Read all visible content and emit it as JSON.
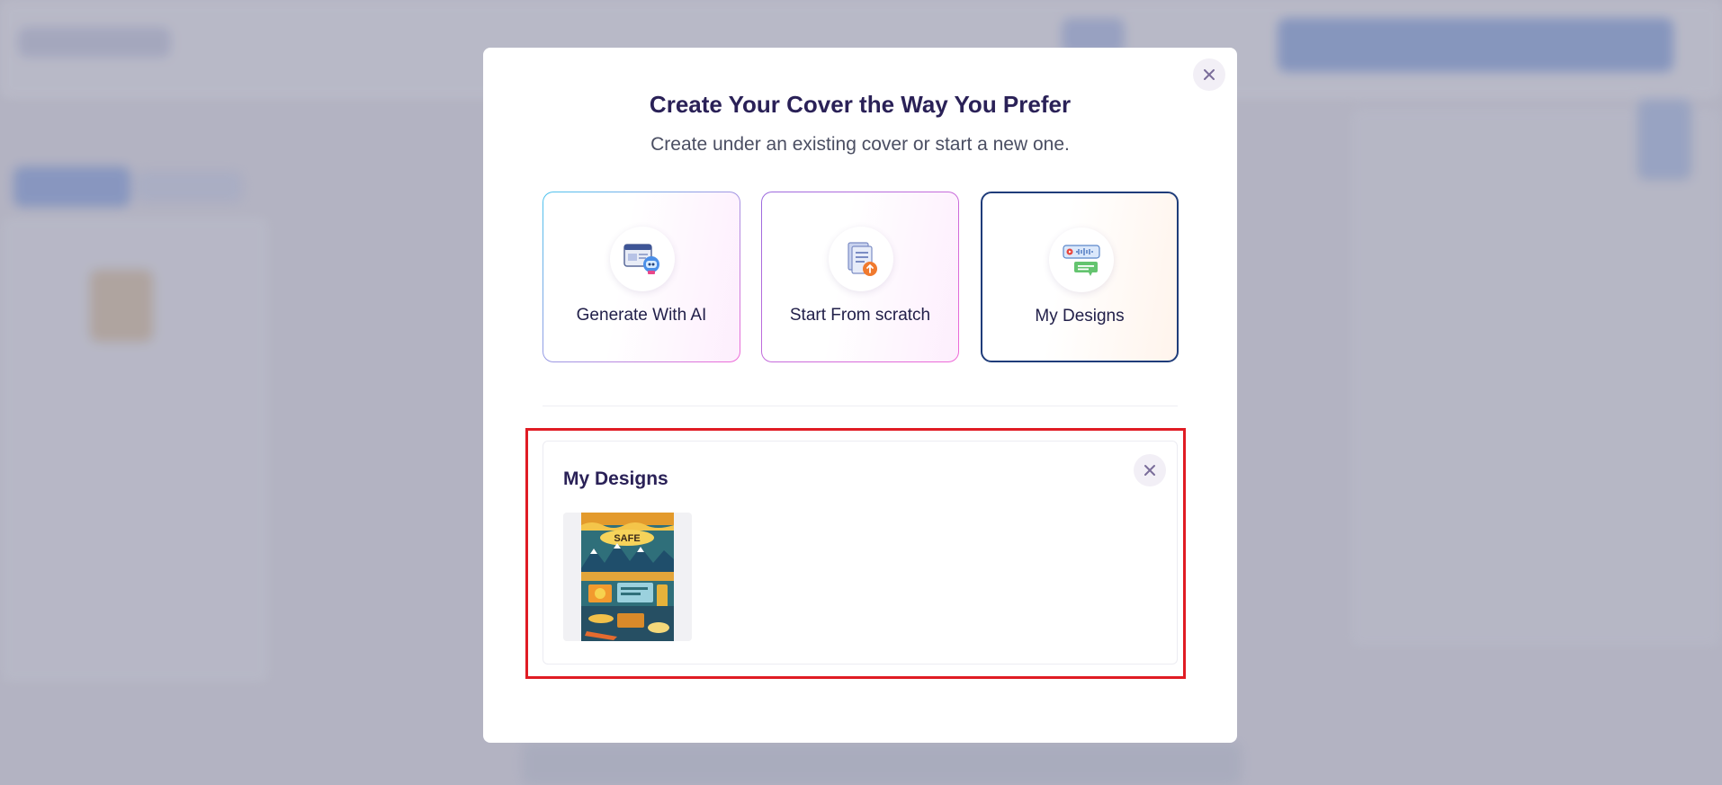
{
  "modal": {
    "title": "Create Your Cover the Way You Prefer",
    "subtitle": "Create under an existing cover or start a new one.",
    "close_icon": "close-icon"
  },
  "options": [
    {
      "label": "Generate With AI",
      "icon": "ai-generate-icon"
    },
    {
      "label": "Start From scratch",
      "icon": "document-upload-icon"
    },
    {
      "label": "My Designs",
      "icon": "chat-designs-icon",
      "selected": true
    }
  ],
  "designs_panel": {
    "title": "My Designs",
    "close_icon": "close-icon",
    "items": [
      {
        "thumbnail_text": "SAFE"
      }
    ]
  },
  "colors": {
    "title": "#2a2157",
    "selected_border": "#1f3c7a",
    "highlight_border": "#e01c24"
  }
}
